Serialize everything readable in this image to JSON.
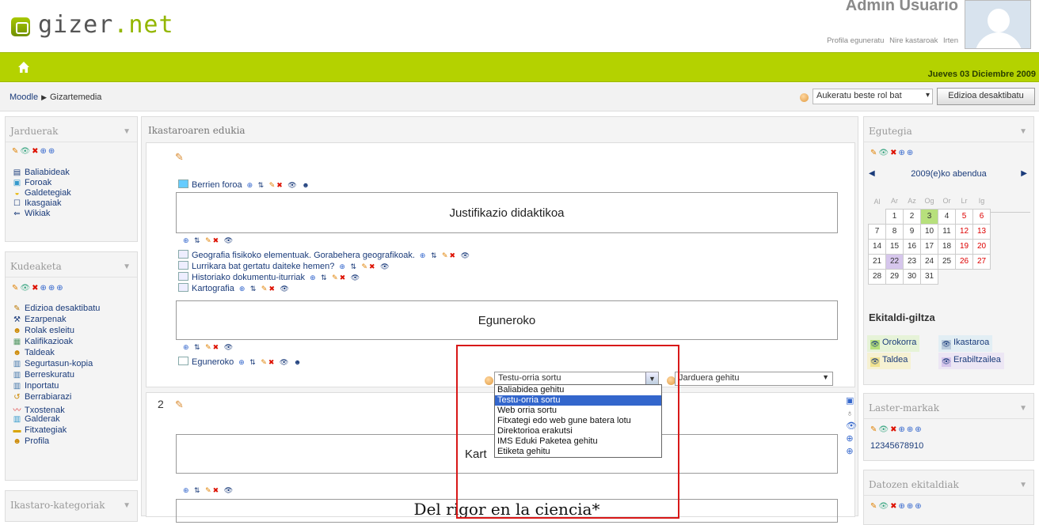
{
  "brand": {
    "logo_text_main": "gizer",
    "logo_text_dot": ".",
    "logo_text_tld": "net"
  },
  "user": {
    "name": "Admin Usuario",
    "links": [
      "Profila eguneratu",
      "Nire kastaroak",
      "Irten"
    ]
  },
  "navbar": {
    "date": "Jueves 03 Diciembre 2009"
  },
  "breadcrumb": {
    "items": [
      "Moodle",
      "Gizartemedia"
    ],
    "role_select": "Aukeratu beste rol bat",
    "edit_button": "Edizioa desaktibatu"
  },
  "left": {
    "jarduerak": {
      "title": "Jarduerak",
      "items": [
        "Baliabideak",
        "Foroak",
        "Galdetegiak",
        "Ikasgaiak",
        "Wikiak"
      ]
    },
    "kudeaketa": {
      "title": "Kudeaketa",
      "items": [
        "Edizioa desaktibatu",
        "Ezarpenak",
        "Rolak esleitu",
        "Kalifikazioak",
        "Taldeak",
        "Segurtasun-kopia",
        "Berreskuratu",
        "Inportatu",
        "Berrabiarazi",
        "Txostenak",
        "Galderak",
        "Fitxategiak",
        "Profila"
      ]
    },
    "kategoriak": {
      "title": "Ikastaro-kategoriak"
    }
  },
  "center": {
    "title": "Ikastaroaren edukia",
    "forum": "Berrien foroa",
    "label1": "Justifikazio didaktikoa",
    "resources": [
      "Geografia fisikoko elementuak. Gorabehera geografikoak.",
      "Lurrikara bat gertatu daiteke hemen?",
      "Historiako dokumentu-iturriak",
      "Kartografia"
    ],
    "label2": "Eguneroko",
    "wiki": "Eguneroko",
    "resource_select": "Testu-orria sortu",
    "activity_select": "Jarduera gehitu",
    "dropdown_options": [
      "Baliabidea gehitu",
      "Testu-orria sortu",
      "Web orria sortu",
      "Fitxategi edo web gune batera lotu",
      "Direktorioa erakutsi",
      "IMS Eduki Paketea gehitu",
      "Etiketa gehitu"
    ],
    "section2_number": "2",
    "label3_partial": "Kart",
    "bottom_heading": "Del rigor en la ciencia*"
  },
  "right": {
    "calendar": {
      "title": "Egutegia",
      "month": "2009(e)ko abendua",
      "weekdays": [
        "Al",
        "Ar",
        "Az",
        "Og",
        "Or",
        "Lr",
        "Ig"
      ],
      "weeks": [
        [
          "",
          "1",
          "2",
          "3",
          "4",
          "5",
          "6"
        ],
        [
          "7",
          "8",
          "9",
          "10",
          "11",
          "12",
          "13"
        ],
        [
          "14",
          "15",
          "16",
          "17",
          "18",
          "19",
          "20"
        ],
        [
          "21",
          "22",
          "23",
          "24",
          "25",
          "26",
          "27"
        ],
        [
          "28",
          "29",
          "30",
          "31",
          "",
          "",
          ""
        ]
      ]
    },
    "keys": {
      "title": "Ekitaldi-giltza",
      "items": [
        "Orokorra",
        "Ikastaroa",
        "Taldea",
        "Erabiltzailea"
      ]
    },
    "bookmarks": {
      "title": "Laster-markak",
      "numbers": "12345678910"
    },
    "events": {
      "title": "Datozen ekitaldiak"
    }
  },
  "colors": {
    "accent_green": "#b4d200",
    "link_blue": "#1a3b7a",
    "highlight": "#3366cc",
    "annotation_red": "#d81818"
  }
}
